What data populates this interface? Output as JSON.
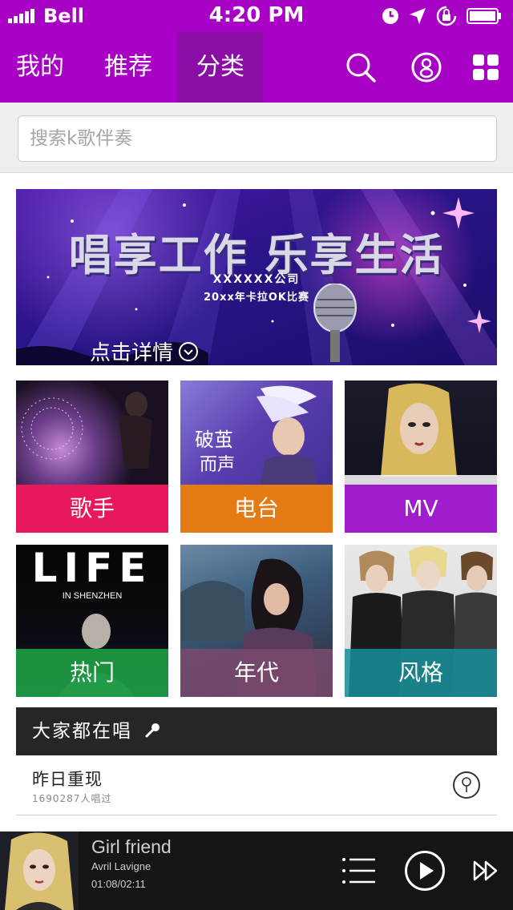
{
  "status_bar": {
    "carrier": "Bell",
    "time": "4:20 PM"
  },
  "top_nav": {
    "tabs": [
      {
        "label": "我的",
        "active": false
      },
      {
        "label": "推荐",
        "active": false
      },
      {
        "label": "分类",
        "active": true
      }
    ],
    "icons": [
      "search-icon",
      "profile-icon",
      "grid-menu-icon"
    ],
    "colors": {
      "bar": "#a800c4",
      "active_tab": "#8a0ea6"
    }
  },
  "search": {
    "placeholder": "搜索k歌伴奏"
  },
  "banner": {
    "title": "唱享工作  乐享生活",
    "line1": "XXXXXX公司",
    "line2": "20xx年卡拉OK比赛",
    "cta": "点击详情"
  },
  "categories": [
    {
      "label": "歌手",
      "color": "#e8195a"
    },
    {
      "label": "电台",
      "color": "#e47b14"
    },
    {
      "label": "MV",
      "color": "#a11ccc"
    },
    {
      "label": "热门",
      "color": "#1fa844"
    },
    {
      "label": "年代",
      "color": "#7a4a6e"
    },
    {
      "label": "风格",
      "color": "#178f9a"
    }
  ],
  "thumbnail_text": {
    "life": "LIFE",
    "life_sub": "IN SHENZHEN"
  },
  "popular": {
    "heading": "大家都在唱",
    "songs": [
      {
        "title": "昨日重现",
        "count": "1690287人唱过"
      }
    ]
  },
  "player": {
    "title": "Girl friend",
    "artist": "Avril Lavigne",
    "time": "01:08/02:11"
  }
}
